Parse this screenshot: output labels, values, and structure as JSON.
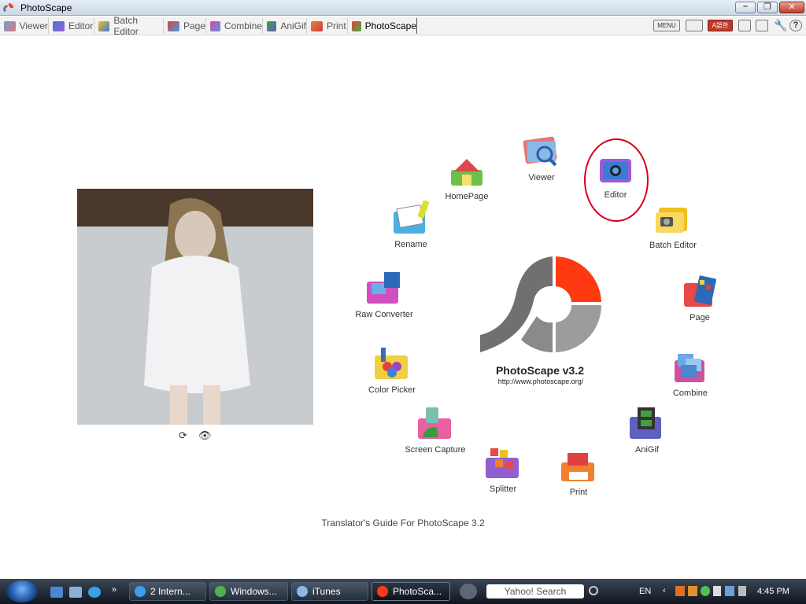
{
  "window": {
    "title": "PhotoScape"
  },
  "tabs": [
    {
      "label": "Viewer",
      "icon": "viewer-icon"
    },
    {
      "label": "Editor",
      "icon": "editor-icon"
    },
    {
      "label": "Batch Editor",
      "icon": "batch-editor-icon"
    },
    {
      "label": "Page",
      "icon": "page-icon"
    },
    {
      "label": "Combine",
      "icon": "combine-icon"
    },
    {
      "label": "AniGif",
      "icon": "anigif-icon"
    },
    {
      "label": "Print",
      "icon": "print-icon"
    },
    {
      "label": "PhotoScape",
      "icon": "photoscape-icon",
      "active": true
    }
  ],
  "toolbar": {
    "menu_label": "MENU",
    "lang_label": "A語한"
  },
  "launchers": [
    {
      "label": "HomePage",
      "icon": "home-icon"
    },
    {
      "label": "Viewer",
      "icon": "viewer-icon"
    },
    {
      "label": "Editor",
      "icon": "editor-icon"
    },
    {
      "label": "Batch Editor",
      "icon": "batch-editor-icon"
    },
    {
      "label": "Page",
      "icon": "page-icon"
    },
    {
      "label": "Combine",
      "icon": "combine-icon"
    },
    {
      "label": "AniGif",
      "icon": "anigif-icon"
    },
    {
      "label": "Print",
      "icon": "print-icon"
    },
    {
      "label": "Splitter",
      "icon": "splitter-icon"
    },
    {
      "label": "Screen Capture",
      "icon": "screen-capture-icon"
    },
    {
      "label": "Color Picker",
      "icon": "color-picker-icon"
    },
    {
      "label": "Raw Converter",
      "icon": "raw-converter-icon"
    },
    {
      "label": "Rename",
      "icon": "rename-icon"
    }
  ],
  "logo": {
    "title": "PhotoScape v3.2",
    "url": "http://www.photoscape.org/"
  },
  "guide_link": "Translator's Guide For PhotoScape 3.2",
  "taskbar": {
    "items": [
      {
        "label": "2 Intern...",
        "icon": "ie-icon"
      },
      {
        "label": "Windows...",
        "icon": "messenger-icon"
      },
      {
        "label": "iTunes",
        "icon": "itunes-icon"
      },
      {
        "label": "PhotoSca...",
        "icon": "photoscape-icon",
        "active": true
      }
    ],
    "search_placeholder": "Yahoo! Search",
    "language": "EN",
    "time": "4:45 PM"
  },
  "colors": {
    "accent": "#ff3a12",
    "highlight": "#d9001b",
    "logo_gray": "#8a8a8a"
  }
}
